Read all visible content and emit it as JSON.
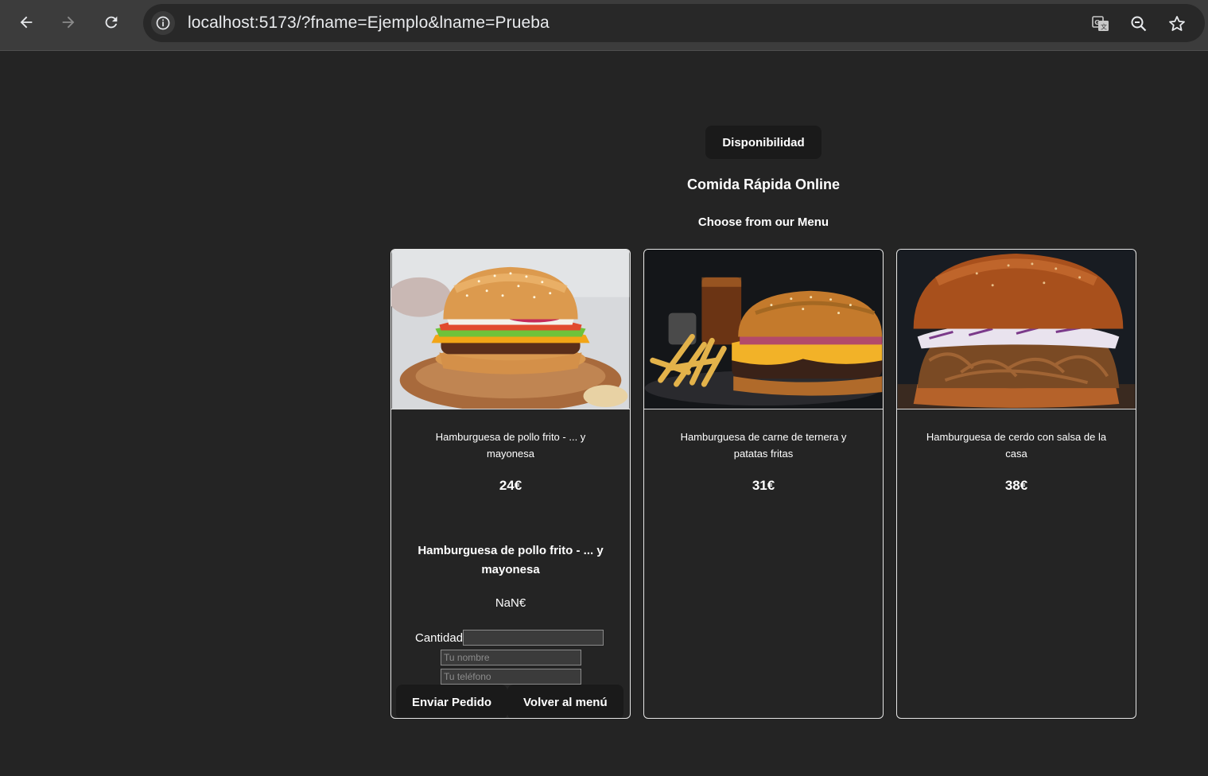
{
  "browser": {
    "url": "localhost:5173/?fname=Ejemplo&lname=Prueba",
    "icons": [
      "back-icon",
      "forward-icon",
      "reload-icon",
      "site-info-icon",
      "translate-icon",
      "zoom-icon",
      "bookmark-star-icon"
    ]
  },
  "page": {
    "availability_button": "Disponibilidad",
    "title": "Comida Rápida Online",
    "subtitle": "Choose from our Menu"
  },
  "products": [
    {
      "name": "Hamburguesa de pollo frito - ... y mayonesa",
      "price": "24€"
    },
    {
      "name": "Hamburguesa de carne de ternera y patatas fritas",
      "price": "31€"
    },
    {
      "name": "Hamburguesa de cerdo con salsa de la casa",
      "price": "38€"
    }
  ],
  "order": {
    "product_name": "Hamburguesa de pollo frito - ... y mayonesa",
    "price": "NaN€",
    "quantity_label": "Cantidad",
    "quantity_value": "",
    "name_placeholder": "Tu nombre",
    "phone_placeholder": "Tu teléfono",
    "submit_label": "Enviar Pedido",
    "back_label": "Volver al menú"
  },
  "colors": {
    "page_background": "#242424",
    "button_background": "#1a1a1a",
    "card_border": "#e6e6e6"
  }
}
